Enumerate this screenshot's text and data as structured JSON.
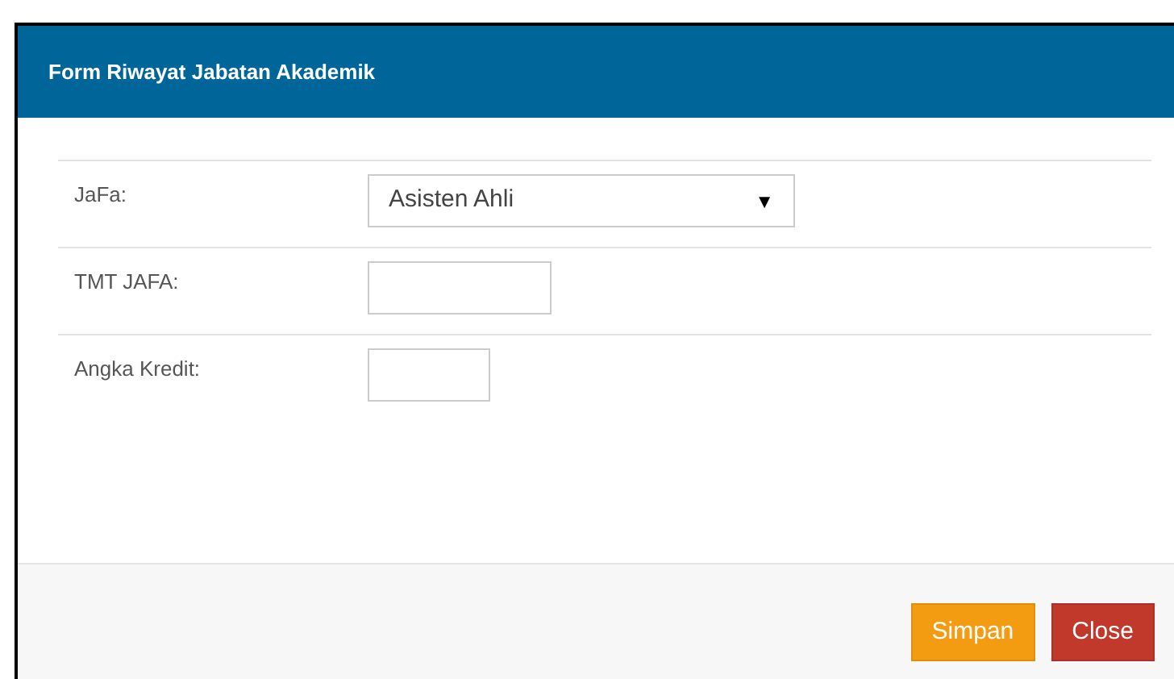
{
  "dialog": {
    "title": "Form Riwayat Jabatan Akademik"
  },
  "fields": [
    {
      "label": "JaFa:",
      "kind": "select",
      "value": "Asisten Ahli",
      "caret": "▼"
    },
    {
      "label": "TMT JAFA:",
      "kind": "date"
    },
    {
      "label": "Angka Kredit:",
      "kind": "number"
    }
  ],
  "buttons": [
    {
      "label": "Simpan",
      "kind": "warning"
    },
    {
      "label": "Close",
      "kind": "danger"
    }
  ]
}
